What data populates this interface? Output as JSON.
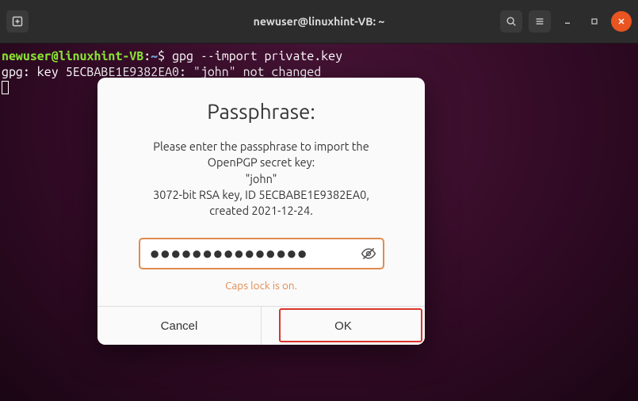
{
  "window": {
    "title": "newuser@linuxhint-VB: ~"
  },
  "terminal": {
    "user_host": "newuser@linuxhint-VB",
    "colon": ":",
    "path": "~",
    "prompt": "$ ",
    "command": "gpg --import private.key",
    "output_line": "gpg: key 5ECBABE1E9382EA0: \"john\" not changed"
  },
  "dialog": {
    "title": "Passphrase:",
    "line1": "Please enter the passphrase to import the",
    "line2": "OpenPGP secret key:",
    "line3": "\"john\"",
    "line4": "3072-bit RSA key, ID 5ECBABE1E9382EA0,",
    "line5": "created 2021-12-24.",
    "password_mask": "●●●●●●●●●●●●●●●",
    "caps_warning": "Caps lock is on.",
    "cancel": "Cancel",
    "ok": "OK"
  },
  "icons": {
    "new_tab": "new-tab-icon",
    "search": "search-icon",
    "menu": "hamburger-icon",
    "minimize": "minimize-icon",
    "maximize": "maximize-icon",
    "close": "close-icon",
    "eye": "eye-hidden-icon"
  }
}
